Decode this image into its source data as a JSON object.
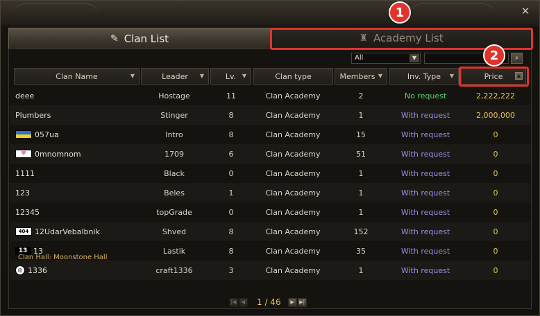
{
  "window": {
    "close_icon": "close-icon"
  },
  "tabs": {
    "clan_list": "Clan List",
    "academy_list": "Academy List"
  },
  "annotations": {
    "marker_1": "1",
    "marker_2": "2"
  },
  "filter": {
    "select_value": "All",
    "search_value": ""
  },
  "columns": {
    "name": "Clan Name",
    "leader": "Leader",
    "level": "Lv.",
    "type": "Clan type",
    "members": "Members",
    "inv_type": "Inv. Type",
    "price": "Price"
  },
  "rows": [
    {
      "name": "deee",
      "leader": "Hostage",
      "level": "11",
      "type": "Clan Academy",
      "members": "2",
      "inv": "No request",
      "price": "2,222,222"
    },
    {
      "name": "Plumbers",
      "leader": "Stinger",
      "level": "8",
      "type": "Clan Academy",
      "members": "1",
      "inv": "With request",
      "price": "2,000,000"
    },
    {
      "name": "057ua",
      "leader": "Intro",
      "level": "8",
      "type": "Clan Academy",
      "members": "15",
      "inv": "With request",
      "price": "0"
    },
    {
      "name": "0mnomnom",
      "leader": "1709",
      "level": "6",
      "type": "Clan Academy",
      "members": "51",
      "inv": "With request",
      "price": "0"
    },
    {
      "name": "1111",
      "leader": "Black",
      "level": "0",
      "type": "Clan Academy",
      "members": "1",
      "inv": "With request",
      "price": "0"
    },
    {
      "name": "123",
      "leader": "Beles",
      "level": "1",
      "type": "Clan Academy",
      "members": "1",
      "inv": "With request",
      "price": "0"
    },
    {
      "name": "12345",
      "leader": "topGrade",
      "level": "0",
      "type": "Clan Academy",
      "members": "1",
      "inv": "With request",
      "price": "0"
    },
    {
      "name": "12UdarVebalbnik",
      "leader": "Shved",
      "level": "8",
      "type": "Clan Academy",
      "members": "152",
      "inv": "With request",
      "price": "0"
    },
    {
      "name": "13",
      "leader": "Lastik",
      "level": "8",
      "type": "Clan Academy",
      "members": "35",
      "inv": "With request",
      "price": "0"
    },
    {
      "name": "1336",
      "leader": "craft1336",
      "level": "3",
      "type": "Clan Academy",
      "members": "1",
      "inv": "With request",
      "price": "0"
    }
  ],
  "crests": {
    "ua": "",
    "heart": "♥",
    "r404": "404",
    "r13": "13",
    "round": "◎"
  },
  "clan_hall_note": "Clan Hall: Moonstone Hall",
  "pager": {
    "text": "1 / 46"
  },
  "colors": {
    "no_request": "#5fd06b",
    "with_request": "#9d8ae6",
    "price": "#e8c64e",
    "annotation": "#e0332c"
  }
}
